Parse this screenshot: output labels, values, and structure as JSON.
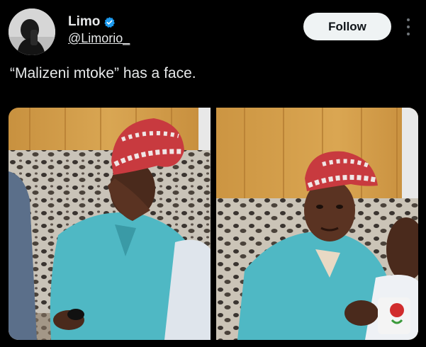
{
  "author": {
    "display_name": "Limo",
    "handle": "@Limorio_",
    "verified": true,
    "avatar_icon": "user-avatar"
  },
  "actions": {
    "follow_label": "Follow",
    "more_icon": "more-vertical-icon"
  },
  "tweet": {
    "text": "“Malizeni mtoke” has a face."
  },
  "colors": {
    "background": "#000000",
    "verified_blue": "#1d9bf0",
    "follow_bg": "#eff3f4"
  }
}
